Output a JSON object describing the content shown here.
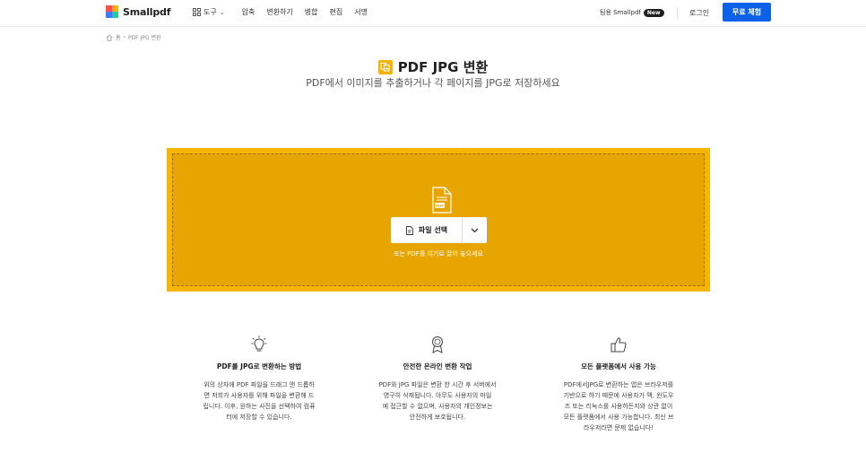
{
  "header": {
    "logo_text": "Smallpdf",
    "tools_label": "도구",
    "nav_items": [
      "압축",
      "변환하기",
      "병합",
      "편집",
      "서명"
    ],
    "promo_text": "팀용 Smallpdf",
    "new_badge": "New",
    "login_label": "로그인",
    "trial_label": "무료 체험"
  },
  "breadcrumb": {
    "home_label": "홈",
    "separator": "›",
    "current": "PDF JPG 변환"
  },
  "hero": {
    "title": "PDF JPG 변환",
    "subtitle": "PDF에서 이미지를 추출하거나 각 페이지를 JPG로 저장하세요"
  },
  "dropzone": {
    "choose_label": "파일 선택",
    "hint": "또는 PDF를 여기로 끌어 놓으세요",
    "file_badge": "PDF"
  },
  "features": [
    {
      "icon": "lightbulb-icon",
      "title": "PDF를 JPG로 변환하는 방법",
      "lines": [
        "위의 상자에 PDF 파일을 드래그 앤 드롭하",
        "면 저희가 사용자를 위해 파일을 변환해 드",
        "립니다. 이후, 원하는 사진을 선택하여 컴퓨",
        "터에 저장할 수 있습니다."
      ]
    },
    {
      "icon": "award-ribbon-icon",
      "title": "안전한 온라인 변환 작업",
      "lines": [
        "PDF와 JPG 파일은 변환 한 시간 후 서버에서",
        "영구히 삭제됩니다. 아무도 사용자의 파일",
        "에 접근할 수 없으며, 사용자의 개인정보는",
        "안전하게 보호됩니다."
      ]
    },
    {
      "icon": "thumbs-up-icon",
      "title": "모든 플랫폼에서 사용 가능",
      "lines": [
        "PDF에서JPG로 변환하는 앱은 브라우저를",
        "기반으로 하기 때문에 사용자가 맥, 윈도우",
        "즈 또는 리눅스를 사용하든지와 상관 없이",
        "모든 플랫폼에서 사용 가능합니다. 최신 브",
        "라우저라면 문제 없습니다!"
      ]
    }
  ],
  "colors": {
    "accent_blue": "#0b62e8",
    "dropzone_fill": "#e6a500",
    "dropzone_border": "#f5b500"
  }
}
